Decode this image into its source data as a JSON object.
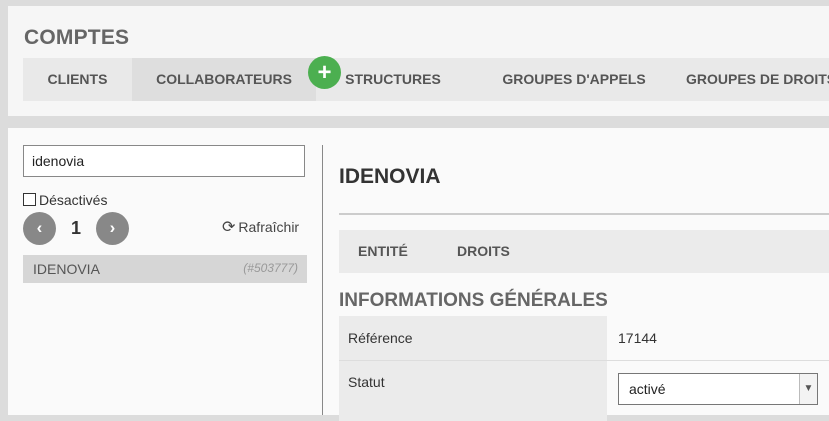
{
  "header": {
    "title": "COMPTES",
    "tabs": [
      {
        "label": "CLIENTS"
      },
      {
        "label": "COLLABORATEURS"
      },
      {
        "label": "STRUCTURES"
      },
      {
        "label": "GROUPES D'APPELS"
      },
      {
        "label": "GROUPES DE DROITS"
      }
    ],
    "active_tab": "COLLABORATEURS",
    "add_label": "+"
  },
  "sidebar": {
    "search_value": "idenovia",
    "deactivated_label": "Désactivés",
    "deactivated_checked": false,
    "pager": {
      "prev": "‹",
      "page": "1",
      "next": "›"
    },
    "refresh_label": "Rafraîchir",
    "results": [
      {
        "name": "IDENOVIA",
        "id": "(#503777)"
      }
    ]
  },
  "detail": {
    "title": "IDENOVIA",
    "tabs": [
      {
        "label": "ENTITÉ"
      },
      {
        "label": "DROITS"
      }
    ],
    "section_title": "INFORMATIONS GÉNÉRALES",
    "fields": [
      {
        "label": "Référence",
        "value": "17144"
      },
      {
        "label": "Statut",
        "value": "activé"
      }
    ]
  },
  "colors": {
    "accent_add_button": "#4caf50",
    "pager_button": "#888888",
    "active_tab": "#dedede"
  },
  "icons": {
    "refresh": "refresh-icon",
    "add": "plus-icon",
    "select_arrow": "chevron-down-icon"
  }
}
